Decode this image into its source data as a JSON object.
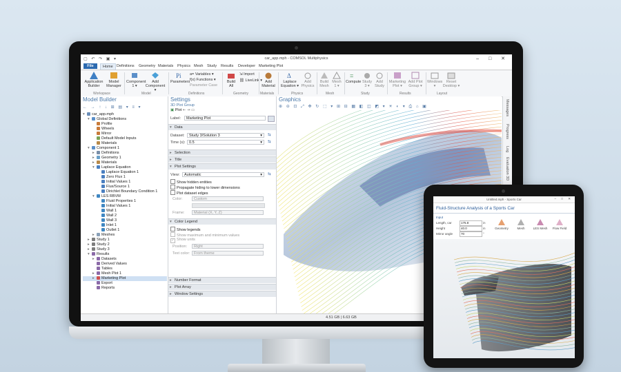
{
  "window": {
    "title": "car_app.mph - COMSOL Multiphysics",
    "quick_access": "▢ ↶ ↷ ▣ ▾",
    "controls": "–  □  ✕"
  },
  "menu": {
    "file": "File",
    "items": [
      "Home",
      "Definitions",
      "Geometry",
      "Materials",
      "Physics",
      "Mesh",
      "Study",
      "Results",
      "Developer",
      "Marketing Plot"
    ]
  },
  "ribbon": {
    "app_builder": [
      "Application",
      "Builder"
    ],
    "model_manager": [
      "Model",
      "Manager"
    ],
    "component": [
      "Component",
      "1 ▾"
    ],
    "add_component": [
      "Add",
      "Component ▾"
    ],
    "parameters": "Parameters",
    "variables": "Variables ▾",
    "functions": "Functions ▾",
    "parameter_case": "Parameter Case",
    "build_all": [
      "Build",
      "All"
    ],
    "import": "Import",
    "livelink": "LiveLink ▾",
    "add_material": [
      "Add",
      "Material"
    ],
    "laplace": [
      "Laplace",
      "Equation ▾"
    ],
    "add_physics": [
      "Add",
      "Physics"
    ],
    "build_mesh": [
      "Build",
      "Mesh"
    ],
    "mesh1": [
      "Mesh",
      "1 ▾"
    ],
    "compute": "Compute",
    "study3": [
      "Study",
      "3 ▾"
    ],
    "add_study": [
      "Add",
      "Study"
    ],
    "marketing_plot": [
      "Marketing",
      "Plot ▾"
    ],
    "add_plot_group": [
      "Add Plot",
      "Group ▾"
    ],
    "windows": [
      "Windows",
      "▾"
    ],
    "reset_desktop": [
      "Reset",
      "Desktop ▾"
    ],
    "groups": [
      "Workspace",
      "Model",
      "Definitions",
      "Geometry",
      "Materials",
      "Physics",
      "Mesh",
      "Study",
      "Results",
      "Layout"
    ]
  },
  "model_builder": {
    "title": "Model Builder",
    "tree": [
      {
        "label": "car_app.mph",
        "depth": 0,
        "toggle": "▾",
        "color": "#6a8db8"
      },
      {
        "label": "Global Definitions",
        "depth": 1,
        "toggle": "▾",
        "color": "#5b8fc9"
      },
      {
        "label": "Profile",
        "depth": 2,
        "toggle": "",
        "color": "#c97b3a"
      },
      {
        "label": "Wheels",
        "depth": 2,
        "toggle": "",
        "color": "#c97b3a"
      },
      {
        "label": "Mirror",
        "depth": 2,
        "toggle": "",
        "color": "#c97b3a"
      },
      {
        "label": "Default Model Inputs",
        "depth": 2,
        "toggle": "",
        "color": "#7aa356"
      },
      {
        "label": "Materials",
        "depth": 2,
        "toggle": "",
        "color": "#b88a4a"
      },
      {
        "label": "Component 1",
        "depth": 1,
        "toggle": "▾",
        "color": "#5b8fc9"
      },
      {
        "label": "Definitions",
        "depth": 2,
        "toggle": "▸",
        "color": "#7a8fa8"
      },
      {
        "label": "Geometry 1",
        "depth": 2,
        "toggle": "▸",
        "color": "#6aa0c8"
      },
      {
        "label": "Materials",
        "depth": 2,
        "toggle": "▸",
        "color": "#b88a4a"
      },
      {
        "label": "Laplace Equation",
        "depth": 2,
        "toggle": "▾",
        "color": "#4a7fc0"
      },
      {
        "label": "Laplace Equation 1",
        "depth": 3,
        "toggle": "",
        "color": "#4a7fc0"
      },
      {
        "label": "Zero Flux 1",
        "depth": 3,
        "toggle": "",
        "color": "#4a7fc0"
      },
      {
        "label": "Initial Values 1",
        "depth": 3,
        "toggle": "",
        "color": "#4a7fc0"
      },
      {
        "label": "Flux/Source 1",
        "depth": 3,
        "toggle": "",
        "color": "#4a7fc0"
      },
      {
        "label": "Dirichlet Boundary Condition 1",
        "depth": 3,
        "toggle": "",
        "color": "#4a7fc0"
      },
      {
        "label": "LES RBVM",
        "depth": 2,
        "toggle": "▾",
        "color": "#3f87c2"
      },
      {
        "label": "Fluid Properties 1",
        "depth": 3,
        "toggle": "",
        "color": "#3f87c2"
      },
      {
        "label": "Initial Values 1",
        "depth": 3,
        "toggle": "",
        "color": "#3f87c2"
      },
      {
        "label": "Wall 1",
        "depth": 3,
        "toggle": "",
        "color": "#3f87c2"
      },
      {
        "label": "Wall 2",
        "depth": 3,
        "toggle": "",
        "color": "#3f87c2"
      },
      {
        "label": "Wall 3",
        "depth": 3,
        "toggle": "",
        "color": "#3f87c2"
      },
      {
        "label": "Inlet 1",
        "depth": 3,
        "toggle": "",
        "color": "#3f87c2"
      },
      {
        "label": "Outlet 1",
        "depth": 3,
        "toggle": "",
        "color": "#3f87c2"
      },
      {
        "label": "Meshes",
        "depth": 2,
        "toggle": "▸",
        "color": "#8aa0b8"
      },
      {
        "label": "Study 1",
        "depth": 1,
        "toggle": "▸",
        "color": "#7d7d7d"
      },
      {
        "label": "Study 2",
        "depth": 1,
        "toggle": "▸",
        "color": "#7d7d7d"
      },
      {
        "label": "Study 3",
        "depth": 1,
        "toggle": "▸",
        "color": "#7d7d7d"
      },
      {
        "label": "Results",
        "depth": 1,
        "toggle": "▾",
        "color": "#8b6aa8"
      },
      {
        "label": "Datasets",
        "depth": 2,
        "toggle": "▸",
        "color": "#8b6aa8"
      },
      {
        "label": "Derived Values",
        "depth": 2,
        "toggle": "",
        "color": "#8b6aa8"
      },
      {
        "label": "Tables",
        "depth": 2,
        "toggle": "",
        "color": "#8b6aa8"
      },
      {
        "label": "Mesh Plot 1",
        "depth": 2,
        "toggle": "▸",
        "color": "#8b6aa8"
      },
      {
        "label": "Marketing Plot",
        "depth": 2,
        "toggle": "▸",
        "color": "#d05050",
        "selected": true
      },
      {
        "label": "Export",
        "depth": 2,
        "toggle": "",
        "color": "#8b6aa8"
      },
      {
        "label": "Reports",
        "depth": 2,
        "toggle": "",
        "color": "#8b6aa8"
      }
    ]
  },
  "settings": {
    "title": "Settings",
    "subtitle": "3D Plot Group",
    "plot_button": "Plot",
    "label_field_label": "Label:",
    "label_value": "Marketing Plot",
    "sections": {
      "data": "Data",
      "selection": "Selection",
      "title": "Title",
      "plot_settings": "Plot Settings",
      "color_legend": "Color Legend",
      "number_format": "Number Format",
      "plot_array": "Plot Array",
      "window_settings": "Window Settings"
    },
    "dataset_label": "Dataset:",
    "dataset_value": "Study 3/Solution 3",
    "time_label": "Time (s):",
    "time_value": "0.5",
    "view_label": "View:",
    "view_value": "Automatic",
    "show_hidden": "Show hidden entities",
    "propagate": "Propagate hiding to lower dimensions",
    "plot_edges": "Plot dataset edges",
    "color_label": "Color:",
    "color_value": "Custom",
    "frame_label": "Frame:",
    "frame_value": "Material (X, Y, Z)",
    "show_legends": "Show legends",
    "show_minmax": "Show maximum and minimum values",
    "show_units": "Show units",
    "position_label": "Position:",
    "position_value": "Right",
    "text_color_label": "Text color:",
    "text_color_value": "From theme"
  },
  "graphics": {
    "title": "Graphics"
  },
  "side_tabs": [
    "Messages",
    "Progress",
    "Log",
    "Evaluation 3D"
  ],
  "status": {
    "memory": "4.51 GB | 6.63 GB"
  },
  "tablet": {
    "window_title": "Untitled.mph - Sports Car",
    "app_title": "Fluid-Structure Analysis of a Sports Car",
    "input_header": "Input",
    "inputs": [
      {
        "label": "Length, car",
        "value": "175.8",
        "unit": "in"
      },
      {
        "label": "Height",
        "value": "40.0",
        "unit": "in"
      },
      {
        "label": "Mirror angle",
        "value": "70",
        "unit": "°"
      }
    ],
    "buttons": [
      "Geometry",
      "Mesh",
      "LES Mesh",
      "Flow Field"
    ]
  }
}
